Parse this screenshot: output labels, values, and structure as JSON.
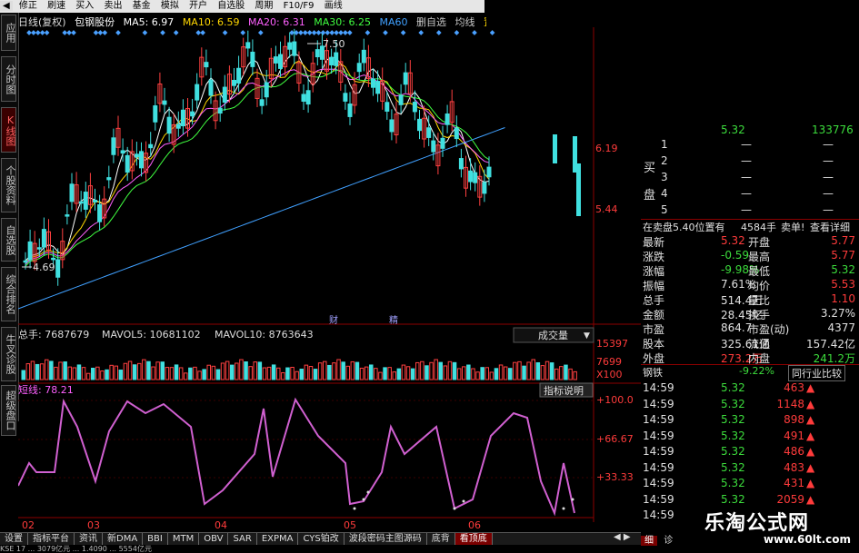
{
  "toolbar": {
    "items": [
      "修正",
      "刷速",
      "买入",
      "卖出",
      "基金",
      "模拟",
      "开户",
      "自选股",
      "周期",
      "F10/F9",
      "画线"
    ]
  },
  "side_tabs": [
    {
      "label": "应用",
      "active": false
    },
    {
      "label": "分时图",
      "active": false
    },
    {
      "label": "K线图",
      "active": true
    },
    {
      "label": "个股资料",
      "active": false
    },
    {
      "label": "自选股",
      "active": false
    },
    {
      "label": "综合排名",
      "active": false
    },
    {
      "label": "牛叉诊股",
      "active": false
    },
    {
      "label": "超级盘口",
      "active": false
    }
  ],
  "info_bar": {
    "period": "日线(复权)",
    "stock": "包钢股份",
    "ma5": "MA5: 6.97",
    "ma10": "MA10: 6.59",
    "ma20": "MA20: 6.31",
    "ma30": "MA30: 6.25",
    "ma60": "MA60",
    "extra1": "删自选",
    "extra2": "均线",
    "extra3": "置"
  },
  "price_chart": {
    "high_label": "7.50",
    "low_label": "4.69",
    "axis_labels": [
      "6.19",
      "5.44"
    ],
    "badges": [
      "财",
      "精"
    ]
  },
  "volume_bar": {
    "total": "总手: 7687679",
    "mavol5": "MAVOL5: 10681102",
    "mavol10": "MAVOL10: 8763643",
    "dropdown": "成交量",
    "axis_labels": [
      "15397",
      "7699",
      "X100"
    ]
  },
  "indicator_bar": {
    "label": "短线: 78.21",
    "help_button": "指标说明",
    "axis_labels": [
      "+100.0",
      "+66.67",
      "+33.33"
    ]
  },
  "x_axis_labels": [
    "02",
    "03",
    "04",
    "05",
    "06"
  ],
  "bottom_tabs": [
    {
      "label": "设置",
      "active": false
    },
    {
      "label": "指标平台",
      "active": false
    },
    {
      "label": "资讯",
      "active": false
    },
    {
      "label": "新DMA",
      "active": false
    },
    {
      "label": "BBI",
      "active": false
    },
    {
      "label": "MTM",
      "active": false
    },
    {
      "label": "OBV",
      "active": false
    },
    {
      "label": "SAR",
      "active": false
    },
    {
      "label": "EXPMA",
      "active": false
    },
    {
      "label": "CYS铂改",
      "active": false
    },
    {
      "label": "波段密码主图源码",
      "active": false
    },
    {
      "label": "底背",
      "active": false
    },
    {
      "label": "看顶底",
      "active": true
    }
  ],
  "right_panel": {
    "top_value": "5.32",
    "top_value2": "133776",
    "buy_label_1": "买",
    "buy_label_2": "盘",
    "buy_rows": [
      {
        "n": "1",
        "p": "—",
        "v": "—"
      },
      {
        "n": "2",
        "p": "—",
        "v": "—"
      },
      {
        "n": "3",
        "p": "—",
        "v": "—"
      },
      {
        "n": "4",
        "p": "—",
        "v": "—"
      },
      {
        "n": "5",
        "p": "—",
        "v": "—"
      }
    ],
    "sell_at": "在卖盘5.40位置有",
    "sell_qty": "4584手",
    "sell_tag": "卖单!",
    "detail_link": "查看详细",
    "stats": [
      {
        "l": "最新",
        "v": "5.32",
        "l2": "开盘",
        "v2": "5.77",
        "c1": "red",
        "c2": "red"
      },
      {
        "l": "涨跌",
        "v": "-0.59",
        "l2": "最高",
        "v2": "5.77",
        "c1": "green",
        "c2": "red"
      },
      {
        "l": "涨幅",
        "v": "-9.98%",
        "l2": "最低",
        "v2": "5.32",
        "c1": "green",
        "c2": "green"
      },
      {
        "l": "振幅",
        "v": "7.61%",
        "l2": "均价",
        "v2": "5.53",
        "c1": "white",
        "c2": "red"
      },
      {
        "l": "总手",
        "v": "514.4万",
        "l2": "量比",
        "v2": "1.10",
        "c1": "white",
        "c2": "red"
      },
      {
        "l": "金额",
        "v": "28.45亿",
        "l2": "换手",
        "v2": "3.27%",
        "c1": "white",
        "c2": "white"
      },
      {
        "l": "市盈",
        "v": "864.7",
        "l2": "市盈(动)",
        "v2": "4377",
        "c1": "white",
        "c2": "white"
      },
      {
        "l": "股本",
        "v": "325.61亿",
        "l2": "流通",
        "v2": "157.42亿",
        "c1": "white",
        "c2": "white"
      },
      {
        "l": "外盘",
        "v": "273.2万",
        "l2": "内盘",
        "v2": "241.2万",
        "c1": "red",
        "c2": "green"
      }
    ],
    "industry": "钢铁",
    "industry_change": "-9.22%",
    "industry_button": "同行业比较",
    "trades": [
      {
        "t": "14:59",
        "p": "5.32",
        "v": "463"
      },
      {
        "t": "14:59",
        "p": "5.32",
        "v": "1148"
      },
      {
        "t": "14:59",
        "p": "5.32",
        "v": "898"
      },
      {
        "t": "14:59",
        "p": "5.32",
        "v": "491"
      },
      {
        "t": "14:59",
        "p": "5.32",
        "v": "486"
      },
      {
        "t": "14:59",
        "p": "5.32",
        "v": "483"
      },
      {
        "t": "14:59",
        "p": "5.32",
        "v": "431"
      },
      {
        "t": "14:59",
        "p": "5.32",
        "v": "2059"
      },
      {
        "t": "14:59",
        "p": "",
        "v": ""
      }
    ],
    "trade_arrow": "▲",
    "bottom_tabs": [
      "细",
      "诊"
    ]
  },
  "status_text": "KSE 17  ...  3079亿元  ...  1.4090  ...  5554亿元",
  "watermark": {
    "title": "乐淘公式网",
    "url": "www.60lt.com"
  },
  "colors": {
    "up": "#ff3b3b",
    "down": "#3cdc3c",
    "cyan": "#40e0e0",
    "magenta": "#d060d0"
  }
}
